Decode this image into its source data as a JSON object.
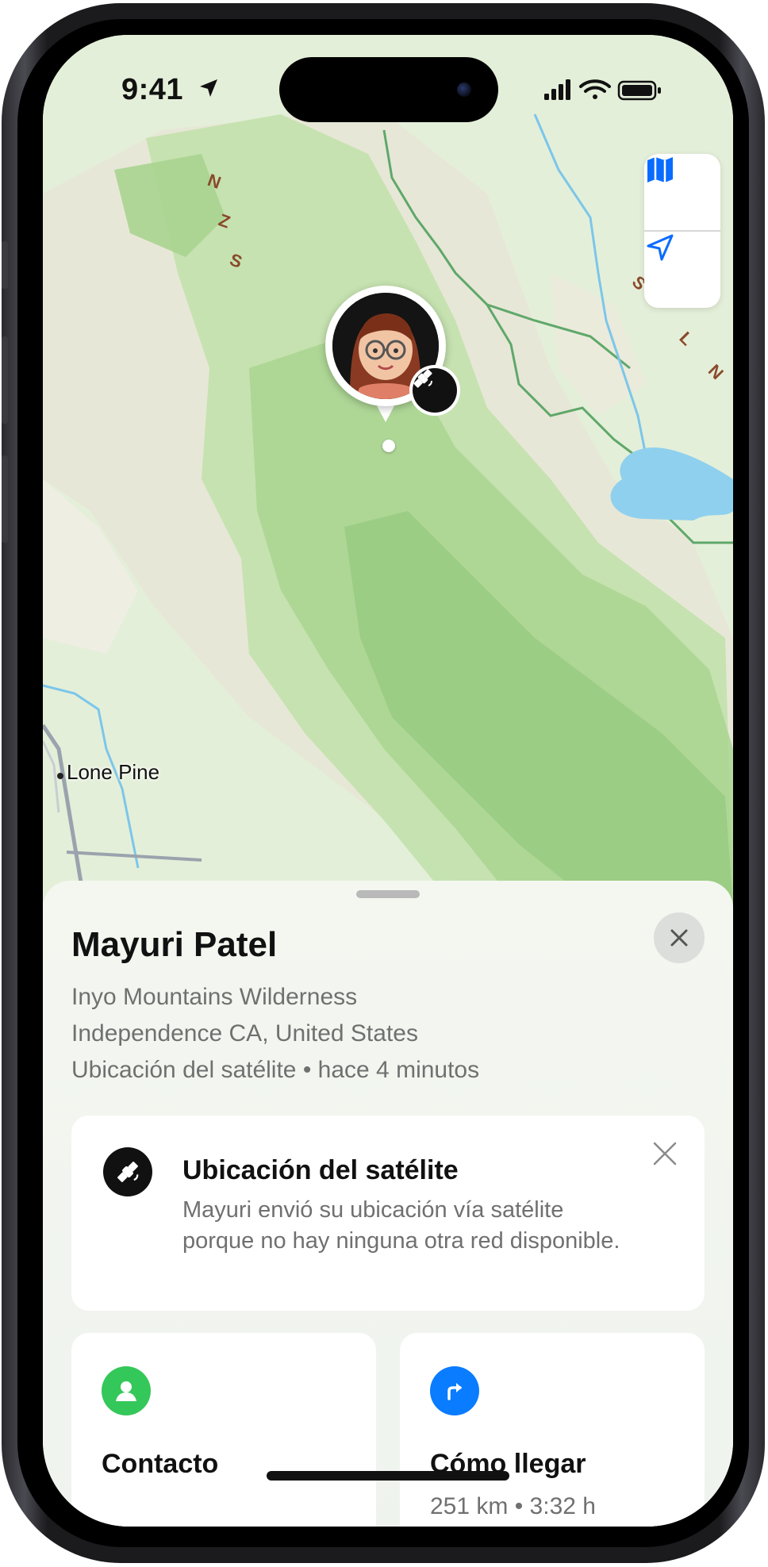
{
  "status_bar": {
    "time": "9:41",
    "location_icon": "location-arrow-icon",
    "signal_icon": "cellular-signal-icon",
    "wifi_icon": "wifi-icon",
    "battery_icon": "battery-icon"
  },
  "map": {
    "town_label": "Lone Pine",
    "controls": {
      "map_mode_icon": "map-icon",
      "locate_icon": "location-arrow-icon"
    },
    "pin": {
      "avatar_icon": "memoji-avatar",
      "badge_icon": "satellite-icon"
    },
    "colors": {
      "land": "#e4efd9",
      "forest": "#b7dca1",
      "boundary": "#5fa86a",
      "water": "#8fd0ee",
      "road": "#9aa3ad"
    }
  },
  "sheet": {
    "name": "Mayuri Patel",
    "lines": [
      "Inyo Mountains Wilderness",
      "Independence CA, United States",
      "Ubicación del satélite • hace 4 minutos"
    ],
    "close_icon": "close-icon",
    "satellite_card": {
      "icon": "satellite-icon",
      "title": "Ubicación del satélite",
      "body": "Mayuri envió su ubicación vía satélite porque no hay ninguna otra red disponible.",
      "dismiss_icon": "close-icon"
    },
    "actions": [
      {
        "icon": "person-icon",
        "label": "Contacto",
        "color": "#34c759"
      },
      {
        "icon": "directions-icon",
        "label": "Cómo llegar",
        "subtitle": "251 km • 3:32 h",
        "color": "#0a7cff"
      }
    ]
  }
}
